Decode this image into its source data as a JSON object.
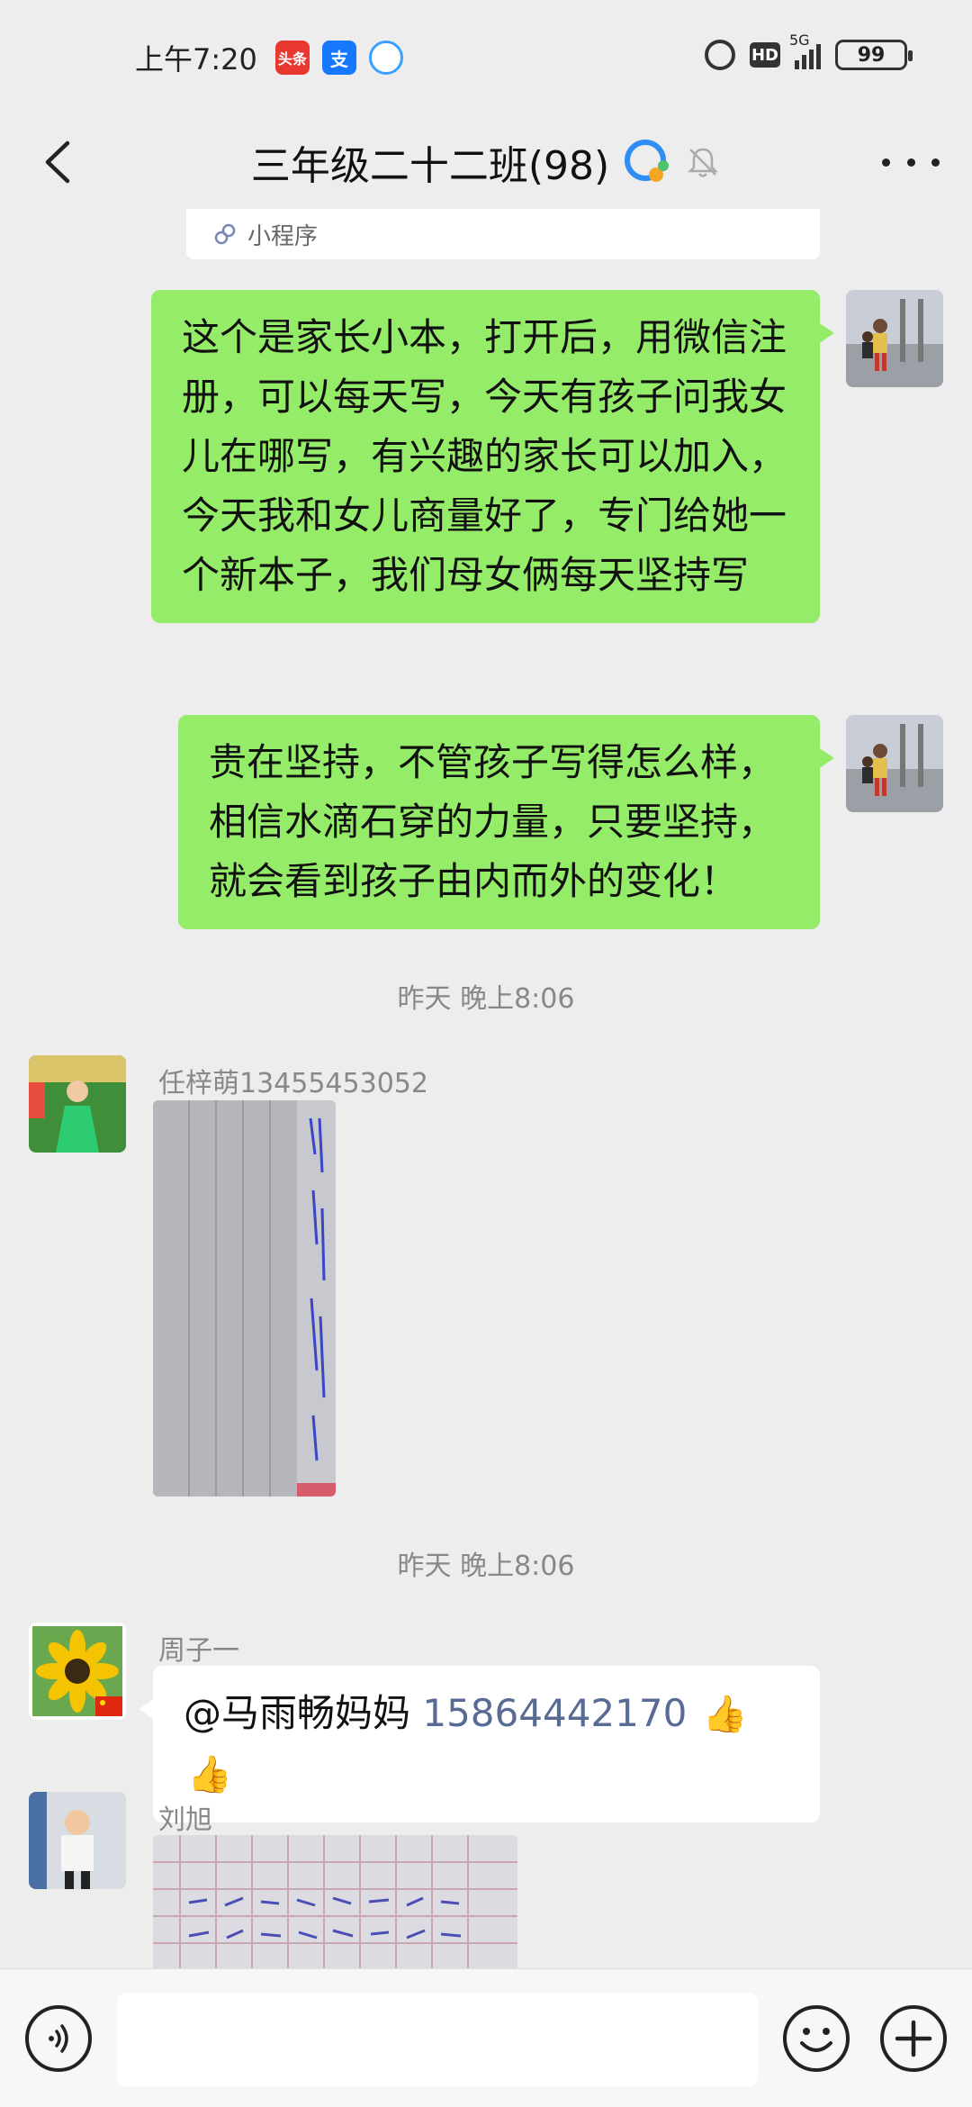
{
  "status_bar": {
    "time": "上午7:20",
    "app_icons": [
      "toutiao-icon",
      "alipay-icon",
      "chat-app-icon"
    ],
    "network_label": "5G",
    "hd_label": "HD",
    "battery": "99"
  },
  "header": {
    "title": "三年级二十二班(98)"
  },
  "chat": {
    "mini_program_label": "小程序",
    "messages": [
      {
        "id": 1,
        "side": "right",
        "text": "这个是家长小本，打开后，用微信注册，可以每天写，今天有孩子问我女儿在哪写，有兴趣的家长可以加入，今天我和女儿商量好了，专门给她一个新本子，我们母女俩每天坚持写"
      },
      {
        "id": 2,
        "side": "right",
        "text": "贵在坚持，不管孩子写得怎么样，相信水滴石穿的力量，只要坚持，就会看到孩子由内而外的变化！"
      },
      {
        "id": 3,
        "type": "timestamp",
        "text": "昨天 晚上8:06"
      },
      {
        "id": 4,
        "side": "left",
        "sender": "任梓萌13455453052",
        "type": "image"
      },
      {
        "id": 5,
        "type": "timestamp",
        "text": "昨天 晚上8:06"
      },
      {
        "id": 6,
        "side": "left",
        "sender": "周子一",
        "mention": "@马雨畅妈妈 ",
        "phone": "15864442170"
      },
      {
        "id": 7,
        "side": "left",
        "sender": "刘旭",
        "type": "image"
      }
    ]
  },
  "input_bar": {
    "value": ""
  },
  "colors": {
    "bubble_self": "#95ec69",
    "bubble_other": "#ffffff",
    "background": "#ededed",
    "link": "#576b95"
  }
}
